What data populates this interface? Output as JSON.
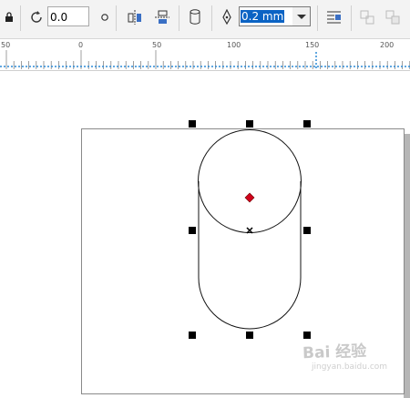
{
  "toolbar": {
    "rotation_value": "0.0",
    "outline_width": "0.2 mm",
    "icons": [
      "lock-icon",
      "rotate-icon",
      "degree-icon",
      "mirror-horizontal-icon",
      "mirror-vertical-icon",
      "cylinder-icon",
      "pen-nib-icon",
      "wrap-text-icon",
      "convert-to-curves-icon",
      "combine-icon"
    ]
  },
  "ruler": {
    "labels": [
      "50",
      "0",
      "50",
      "100",
      "150",
      "200"
    ],
    "accent": "#2e8bd6"
  },
  "watermark": {
    "text": "Bai 经验",
    "sub": "jingyan.baidu.com"
  },
  "colors": {
    "center_marker": "#d0021b",
    "selection_highlight": "#0b63c4"
  }
}
